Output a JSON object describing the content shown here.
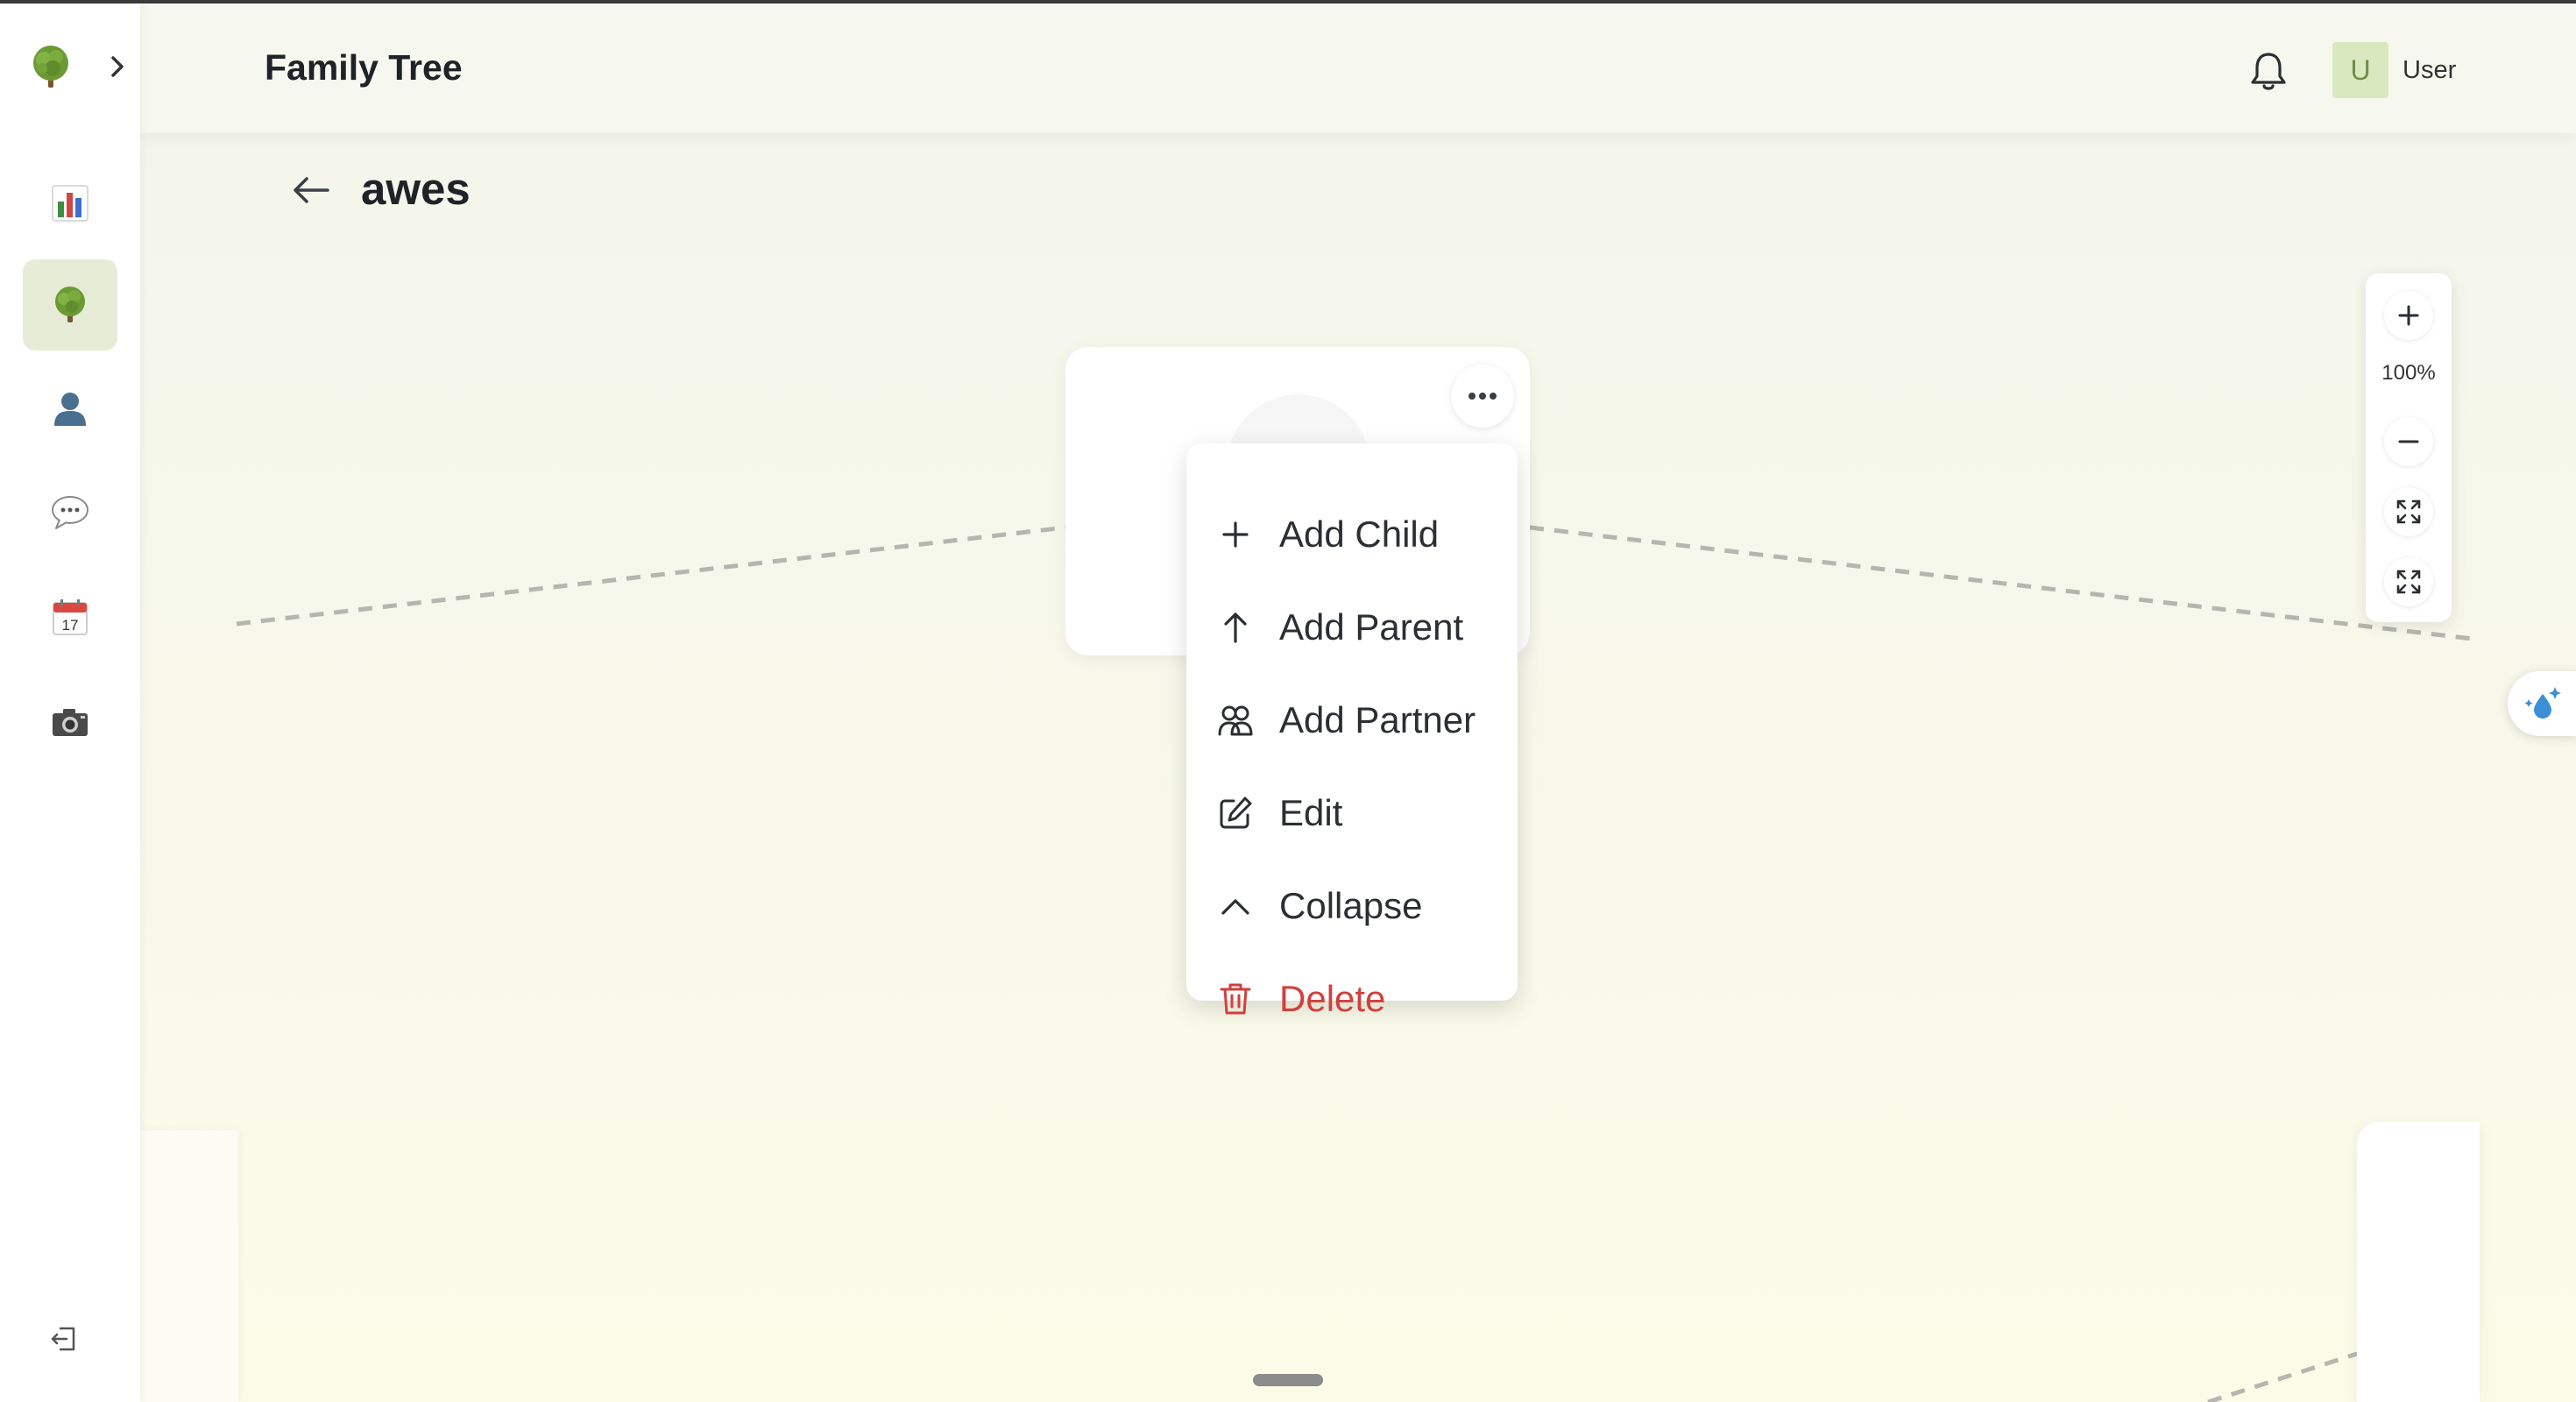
{
  "header": {
    "title": "Family Tree",
    "user_initial": "U",
    "user_name": "User"
  },
  "page": {
    "tree_name": "awes"
  },
  "sidebar": {
    "items": [
      {
        "name": "dashboard",
        "icon": "bar-chart-icon"
      },
      {
        "name": "family-tree",
        "icon": "tree-icon",
        "active": true
      },
      {
        "name": "people",
        "icon": "person-icon"
      },
      {
        "name": "messages",
        "icon": "speech-bubble-icon"
      },
      {
        "name": "calendar",
        "icon": "calendar-icon"
      },
      {
        "name": "photos",
        "icon": "camera-icon"
      }
    ]
  },
  "context_menu": {
    "items": [
      {
        "label": "Add Child",
        "icon": "plus-icon"
      },
      {
        "label": "Add Parent",
        "icon": "arrow-up-icon"
      },
      {
        "label": "Add Partner",
        "icon": "users-icon"
      },
      {
        "label": "Edit",
        "icon": "edit-icon"
      },
      {
        "label": "Collapse",
        "icon": "chevron-up-icon"
      },
      {
        "label": "Delete",
        "icon": "trash-icon",
        "color": "#d1403c"
      }
    ]
  },
  "zoom": {
    "level": "100%"
  },
  "colors": {
    "accent": "#d9e8bf",
    "active_nav": "#e6ecd6",
    "danger": "#d1403c",
    "background": "#f7f8ef"
  }
}
